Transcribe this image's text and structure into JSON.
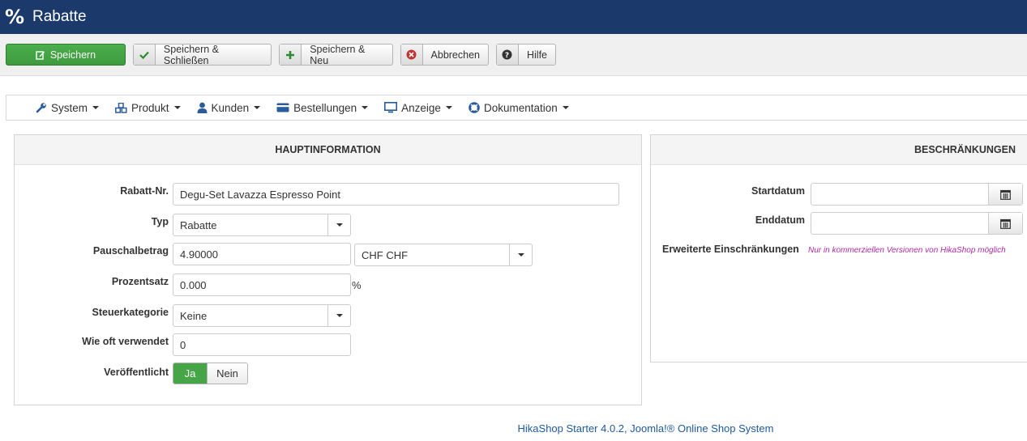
{
  "header": {
    "icon": "percent-icon",
    "logo_glyph": "%",
    "title": "Rabatte",
    "bg_color": "#1b3a6b"
  },
  "toolbar": {
    "save": {
      "label": "Speichern",
      "icon": "edit-icon"
    },
    "save_close": {
      "label": "Speichern & Schließen",
      "icon": "check-icon"
    },
    "save_new": {
      "label": "Speichern & Neu",
      "icon": "plus-icon"
    },
    "cancel": {
      "label": "Abbrechen",
      "icon": "cancel-circle-icon"
    },
    "help": {
      "label": "Hilfe",
      "icon": "question-circle-icon"
    }
  },
  "menu": {
    "items": [
      {
        "label": "System",
        "icon": "wrench-icon"
      },
      {
        "label": "Produkt",
        "icon": "cubes-icon"
      },
      {
        "label": "Kunden",
        "icon": "user-icon"
      },
      {
        "label": "Bestellungen",
        "icon": "credit-card-icon"
      },
      {
        "label": "Anzeige",
        "icon": "monitor-icon"
      },
      {
        "label": "Dokumentation",
        "icon": "lifebuoy-icon"
      }
    ]
  },
  "main_panel": {
    "title": "HAUPTINFORMATION",
    "fields": {
      "code": {
        "label": "Rabatt-Nr.",
        "value": "Degu-Set Lavazza Espresso Point"
      },
      "type": {
        "label": "Typ",
        "value": "Rabatte"
      },
      "flat_amount": {
        "label": "Pauschalbetrag",
        "value": "4.90000",
        "currency": "CHF CHF"
      },
      "percent": {
        "label": "Prozentsatz",
        "value": "0.000",
        "unit": "%"
      },
      "tax_category": {
        "label": "Steuerkategorie",
        "value": "Keine"
      },
      "used_times": {
        "label": "Wie oft verwendet",
        "value": "0"
      },
      "published": {
        "label": "Veröffentlicht",
        "yes": "Ja",
        "no": "Nein",
        "selected": "Ja"
      }
    }
  },
  "restrictions_panel": {
    "title": "BESCHRÄNKUNGEN",
    "start_date": {
      "label": "Startdatum",
      "value": ""
    },
    "end_date": {
      "label": "Enddatum",
      "value": ""
    },
    "advanced": {
      "label": "Erweiterte Einschränkungen",
      "note": "Nur in kommerziellen Versionen von HikaShop möglich"
    }
  },
  "footer": {
    "text": "HikaShop Starter 4.0.2, Joomla!® Online Shop System"
  },
  "colors": {
    "primary_green": "#46a546",
    "link_blue": "#1e5aa0",
    "note_magenta": "#b02aa4"
  }
}
